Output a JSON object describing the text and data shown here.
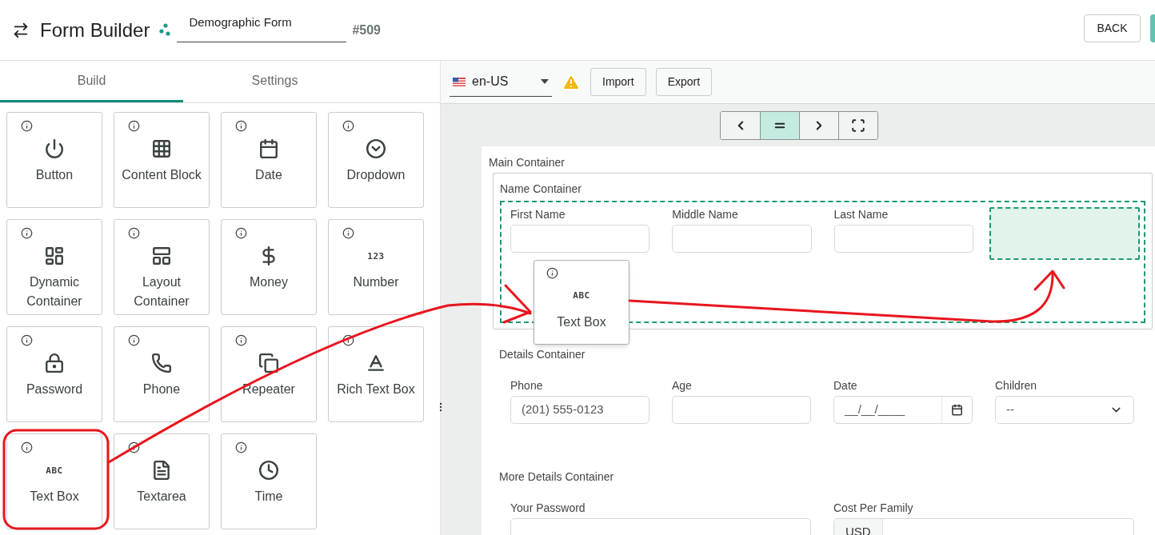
{
  "header": {
    "title": "Form Builder",
    "form_name": "Demographic Form",
    "form_id": "#509",
    "back_button": "BACK"
  },
  "tabs": [
    {
      "label": "Build",
      "selected": true
    },
    {
      "label": "Settings",
      "selected": false
    }
  ],
  "palette": [
    {
      "label": "Button"
    },
    {
      "label": "Content Block"
    },
    {
      "label": "Date"
    },
    {
      "label": "Dropdown"
    },
    {
      "label": "Dynamic Container"
    },
    {
      "label": "Layout Container"
    },
    {
      "label": "Money"
    },
    {
      "label": "Number",
      "glyph": "123"
    },
    {
      "label": "Password"
    },
    {
      "label": "Phone"
    },
    {
      "label": "Repeater"
    },
    {
      "label": "Rich Text Box"
    },
    {
      "label": "Text Box",
      "glyph": "ABC"
    },
    {
      "label": "Textarea"
    },
    {
      "label": "Time"
    }
  ],
  "toolbar": {
    "locale": "en-US",
    "buttons": [
      "Import",
      "Export"
    ]
  },
  "view_controls": [
    {
      "selected": false
    },
    {
      "selected": true
    },
    {
      "selected": false
    },
    {
      "selected": false
    }
  ],
  "canvas": {
    "title": "Main Container",
    "containers": [
      {
        "title": "Name Container",
        "outlined": true,
        "drop_target": true,
        "fields": [
          {
            "kind": "text",
            "label": "First Name"
          },
          {
            "kind": "text",
            "label": "Middle Name"
          },
          {
            "kind": "text",
            "label": "Last Name"
          }
        ]
      },
      {
        "title": "Details Container",
        "outlined": false,
        "drop_target": false,
        "fields": [
          {
            "kind": "text",
            "label": "Phone",
            "value": "(201) 555-0123"
          },
          {
            "kind": "text",
            "label": "Age"
          },
          {
            "kind": "date",
            "label": "Date",
            "placeholder": "__/__/____"
          },
          {
            "kind": "select",
            "label": "Children",
            "value": "--"
          }
        ]
      },
      {
        "title": "More Details Container",
        "outlined": false,
        "drop_target": false,
        "fields": [
          {
            "kind": "password",
            "label": "Your Password"
          },
          {
            "kind": "money",
            "label": "Cost Per Family",
            "prefix": "USD"
          }
        ]
      }
    ]
  },
  "drag_preview": {
    "label": "Text Box",
    "glyph": "ABC"
  }
}
